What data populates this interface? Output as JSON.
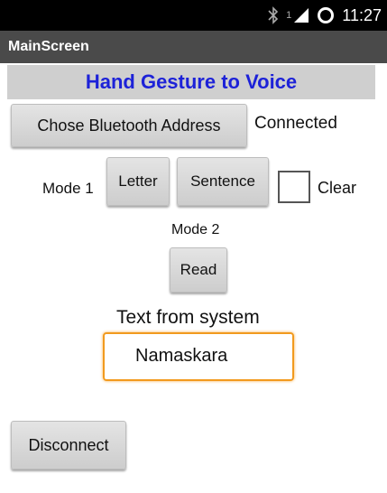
{
  "status": {
    "time": "11:27",
    "signal": "1"
  },
  "app": {
    "screen_title": "MainScreen",
    "header": "Hand Gesture to Voice"
  },
  "bluetooth": {
    "button_label": "Chose Bluetooth Address",
    "status_text": "Connected"
  },
  "mode1": {
    "label": "Mode 1",
    "letter_button": "Letter",
    "sentence_button": "Sentence",
    "clear_label": "Clear"
  },
  "mode2": {
    "label": "Mode 2",
    "read_button": "Read"
  },
  "output": {
    "label": "Text from system",
    "value": "Namaskara"
  },
  "disconnect_button": "Disconnect",
  "colors": {
    "header_text": "#1d22d8",
    "focus_border": "#f29a1e",
    "title_bar": "#4a4a4a"
  }
}
